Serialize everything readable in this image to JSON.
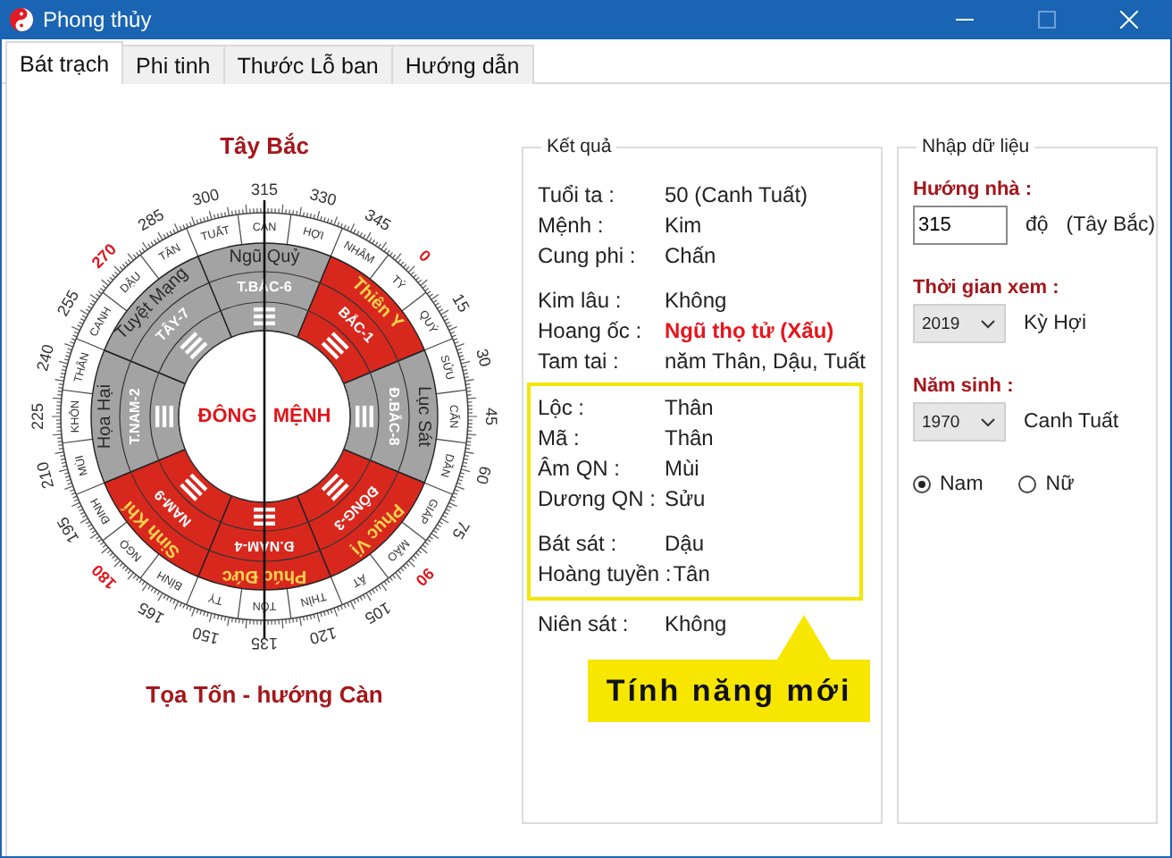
{
  "window": {
    "title": "Phong thủy"
  },
  "tabs": [
    {
      "label": "Bát trạch",
      "selected": true
    },
    {
      "label": "Phi tinh",
      "selected": false
    },
    {
      "label": "Thước Lỗ ban",
      "selected": false
    },
    {
      "label": "Hướng dẫn",
      "selected": false
    }
  ],
  "compass": {
    "top_label": "Tây Bắc",
    "center_label": "ĐÔNG MỆNH",
    "bottom_label": "Tọa Tốn - hướng Càn",
    "sectors": [
      {
        "star": "Thiên Y",
        "palace": "BẮC-1",
        "auspicious": true
      },
      {
        "star": "Lục Sát",
        "palace": "Đ.BẮC-8",
        "auspicious": false
      },
      {
        "star": "Phục Vị",
        "palace": "ĐÔNG-3",
        "auspicious": true
      },
      {
        "star": "Phúc Đức",
        "palace": "Đ.NAM-4",
        "auspicious": true
      },
      {
        "star": "Sinh Khí",
        "palace": "NAM-9",
        "auspicious": true
      },
      {
        "star": "Họa Hại",
        "palace": "T.NAM-2",
        "auspicious": false
      },
      {
        "star": "Tuyệt Mạng",
        "palace": "TÂY-7",
        "auspicious": false
      },
      {
        "star": "Ngũ Quỷ",
        "palace": "T.BẮC-6",
        "auspicious": false
      }
    ],
    "mountains": [
      "TÝ",
      "QUÝ",
      "SỬU",
      "CẤN",
      "DẦN",
      "GIÁP",
      "MÃO",
      "ẤT",
      "THÌN",
      "TỐN",
      "TỴ",
      "BÍNH",
      "NGỌ",
      "ĐINH",
      "MÙI",
      "KHÔN",
      "THÂN",
      "CANH",
      "DẬU",
      "TÂN",
      "TUẤT",
      "CÀN",
      "HỢI",
      "NHÂM"
    ],
    "degrees": [
      {
        "label": "0",
        "major": true
      },
      {
        "label": "15",
        "major": false
      },
      {
        "label": "30",
        "major": false
      },
      {
        "label": "45",
        "major": false
      },
      {
        "label": "60",
        "major": false
      },
      {
        "label": "75",
        "major": false
      },
      {
        "label": "90",
        "major": true
      },
      {
        "label": "105",
        "major": false
      },
      {
        "label": "120",
        "major": false
      },
      {
        "label": "135",
        "major": false
      },
      {
        "label": "150",
        "major": false
      },
      {
        "label": "165",
        "major": false
      },
      {
        "label": "180",
        "major": true
      },
      {
        "label": "195",
        "major": false
      },
      {
        "label": "210",
        "major": false
      },
      {
        "label": "225",
        "major": false
      },
      {
        "label": "240",
        "major": false
      },
      {
        "label": "255",
        "major": false
      },
      {
        "label": "270",
        "major": true
      },
      {
        "label": "285",
        "major": false
      },
      {
        "label": "300",
        "major": false
      },
      {
        "label": "315",
        "major": false
      },
      {
        "label": "330",
        "major": false
      },
      {
        "label": "345",
        "major": false
      }
    ]
  },
  "results": {
    "title": "Kết quả",
    "blocks": [
      {
        "highlighted": false,
        "groups": [
          {
            "rows": [
              {
                "label": "Tuổi ta :",
                "value": "50 (Canh Tuất)",
                "alert": false
              },
              {
                "label": "Mệnh :",
                "value": "Kim",
                "alert": false
              },
              {
                "label": "Cung phi :",
                "value": "Chấn",
                "alert": false
              }
            ]
          },
          {
            "rows": [
              {
                "label": "Kim lâu :",
                "value": "Không",
                "alert": false
              },
              {
                "label": "Hoang ốc :",
                "value": "Ngũ thọ tử (Xấu)",
                "alert": true
              },
              {
                "label": "Tam tai :",
                "value": "năm Thân, Dậu, Tuất",
                "alert": false
              }
            ]
          }
        ]
      },
      {
        "highlighted": true,
        "groups": [
          {
            "rows": [
              {
                "label": "Lộc :",
                "value": "Thân",
                "alert": false
              },
              {
                "label": "Mã :",
                "value": "Thân",
                "alert": false
              },
              {
                "label": "Âm QN :",
                "value": "Mùi",
                "alert": false
              },
              {
                "label": "Dương QN :",
                "value": "Sửu",
                "alert": false
              }
            ]
          },
          {
            "rows": [
              {
                "label": "Bát sát :",
                "value": "Dậu",
                "alert": false
              },
              {
                "label": "Hoàng tuyền :",
                "value": "Tân",
                "alert": false
              }
            ]
          }
        ]
      },
      {
        "highlighted": false,
        "groups": [
          {
            "rows": [
              {
                "label": "Niên sát :",
                "value": "Không",
                "alert": false
              }
            ]
          }
        ]
      }
    ],
    "callout": "Tính năng mới"
  },
  "inputs": {
    "title": "Nhập dữ liệu",
    "fields": [
      {
        "kind": "text",
        "label": "Hướng nhà :",
        "value": "315",
        "suffixes": [
          "độ",
          "(Tây Bắc)"
        ]
      },
      {
        "kind": "select",
        "label": "Thời gian xem :",
        "value": "2019",
        "suffixes": [
          "Kỳ Hợi"
        ]
      },
      {
        "kind": "select",
        "label": "Năm sinh :",
        "value": "1970",
        "suffixes": [
          "Canh Tuất"
        ]
      }
    ],
    "gender": [
      {
        "label": "Nam",
        "selected": true
      },
      {
        "label": "Nữ",
        "selected": false
      }
    ]
  }
}
